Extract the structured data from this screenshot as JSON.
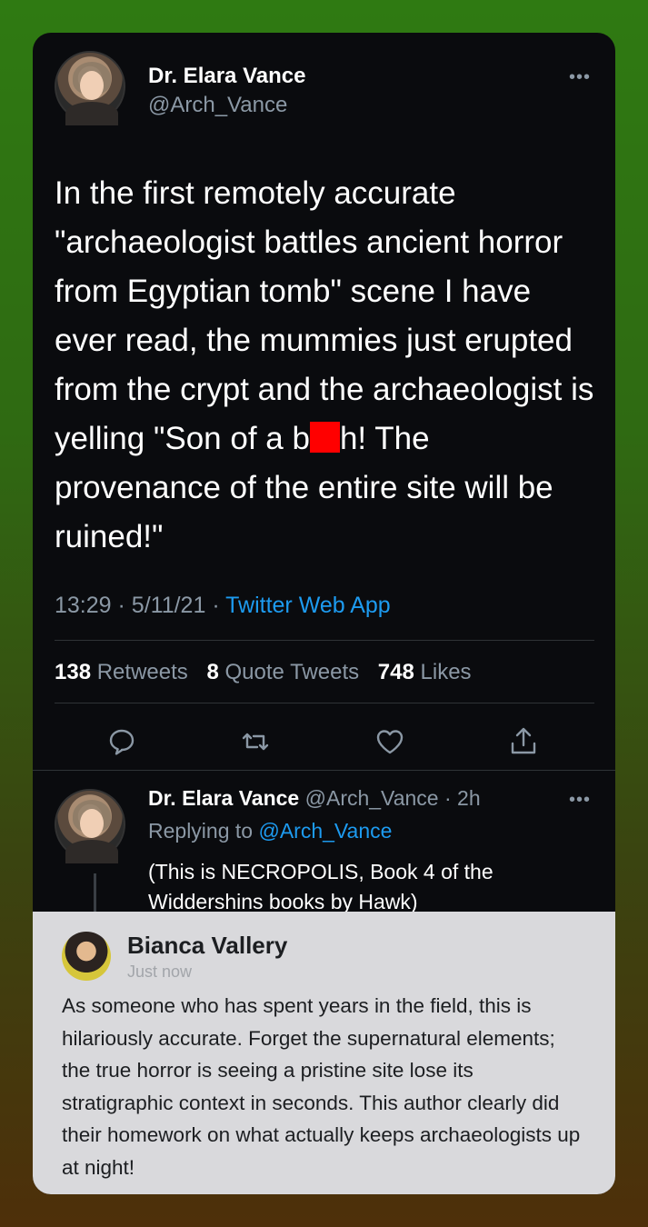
{
  "tweet": {
    "author_name": "Dr. Elara Vance",
    "author_handle": "@Arch_Vance",
    "more": "•••",
    "text_before": "In the first remotely accurate \"archaeologist battles ancient horror from Egyptian tomb\" scene I have ever read, the mummies just erupted from the crypt and the archaeologist is yelling \"Son of a b",
    "text_after": "h! The provenance of the entire site will be ruined!\"",
    "time": "13:29",
    "date": "5/11/21",
    "app": "Twitter Web App",
    "retweets_count": "138",
    "retweets_label": "Retweets",
    "quotes_count": "8",
    "quotes_label": "Quote Tweets",
    "likes_count": "748",
    "likes_label": "Likes"
  },
  "icons": {
    "reply": "reply-icon",
    "retweet": "retweet-icon",
    "like": "heart-icon",
    "share": "share-icon"
  },
  "reply": {
    "author_name": "Dr. Elara Vance",
    "author_handle": "@Arch_Vance",
    "age": "2h",
    "replying_prefix": "Replying to",
    "replying_to": "@Arch_Vance",
    "text": "(This is NECROPOLIS, Book 4 of the Widdershins books by Hawk)",
    "more": "•••"
  },
  "comment": {
    "author_name": "Bianca Vallery",
    "time": "Just now",
    "text": "As someone who has spent years in the field, this is hilariously accurate. Forget the supernatural elements; the true horror is seeing a pristine site lose its stratigraphic context in seconds. This author clearly did their homework on what actually keeps archaeologists up at night!"
  },
  "colors": {
    "accent": "#1d9bf0",
    "redaction": "#ff0000",
    "card_bg": "#0a0b0e",
    "overlay_bg": "#d9d9dc"
  }
}
